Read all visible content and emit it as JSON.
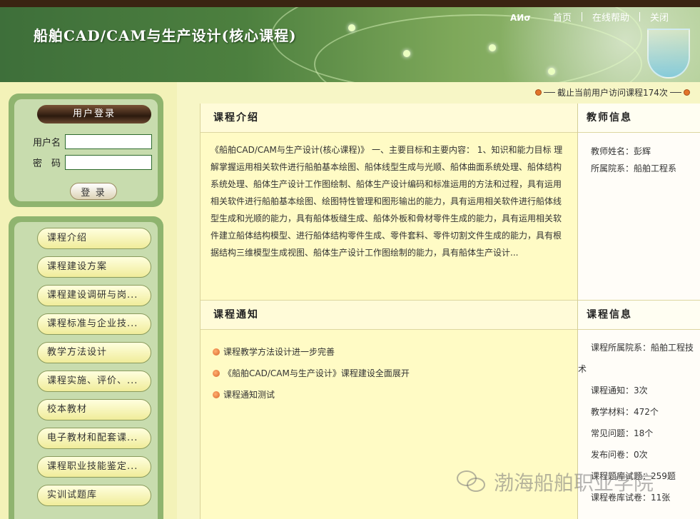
{
  "header": {
    "site_title": "船舶CAD/CAM与生产设计(核心课程)",
    "nav": [
      "首页",
      "在线帮助",
      "关闭"
    ],
    "deco_text": "AИσ"
  },
  "visits_text": "截止当前用户访问课程174次",
  "login": {
    "title": "用户登录",
    "username_label": "用户名",
    "password_label": "密　码",
    "username_value": "",
    "password_value": "",
    "button": "登 录"
  },
  "menu": [
    "课程介绍",
    "课程建设方案",
    "课程建设调研与岗...",
    "课程标准与企业技...",
    "教学方法设计",
    "课程实施、评价、...",
    "校本教材",
    "电子教材和配套课...",
    "课程职业技能鉴定...",
    "实训试题库"
  ],
  "intro": {
    "title": "课程介绍",
    "text": "《船舶CAD/CAM与生产设计(核心课程)》 一、主要目标和主要内容： 1、知识和能力目标 理解掌握运用相关软件进行船舶基本绘图、船体线型生成与光顺、船体曲面系统处理、船体结构系统处理、船体生产设计工作图绘制、船体生产设计编码和标准运用的方法和过程，具有运用相关软件进行船舶基本绘图、绘图特性管理和图形输出的能力，具有运用相关软件进行船体线型生成和光顺的能力，具有船体板缝生成、船体外板和骨材零件生成的能力，具有运用相关软件建立船体结构模型、进行船体结构零件生成、零件套料、零件切割文件生成的能力，具有根据结构三维模型生成视图、船体生产设计工作图绘制的能力，具有船体生产设计..."
  },
  "notice": {
    "title": "课程通知",
    "items": [
      "课程教学方法设计进一步完善",
      "《船舶CAD/CAM与生产设计》课程建设全面展开",
      "课程通知测试"
    ]
  },
  "teacher": {
    "title": "教师信息",
    "name": "教师姓名：彭辉",
    "dept": "所属院系：船舶工程系"
  },
  "course_info": {
    "title": "课程信息",
    "rows": [
      "课程所属院系：船舶工程技术",
      "课程通知：3次",
      "教学材料：472个",
      "常见问题：18个",
      "发布问卷：0次",
      "课程题库试题：259题",
      "课程卷库试卷：11张"
    ]
  },
  "watermark": "渤海船舶职业学院"
}
